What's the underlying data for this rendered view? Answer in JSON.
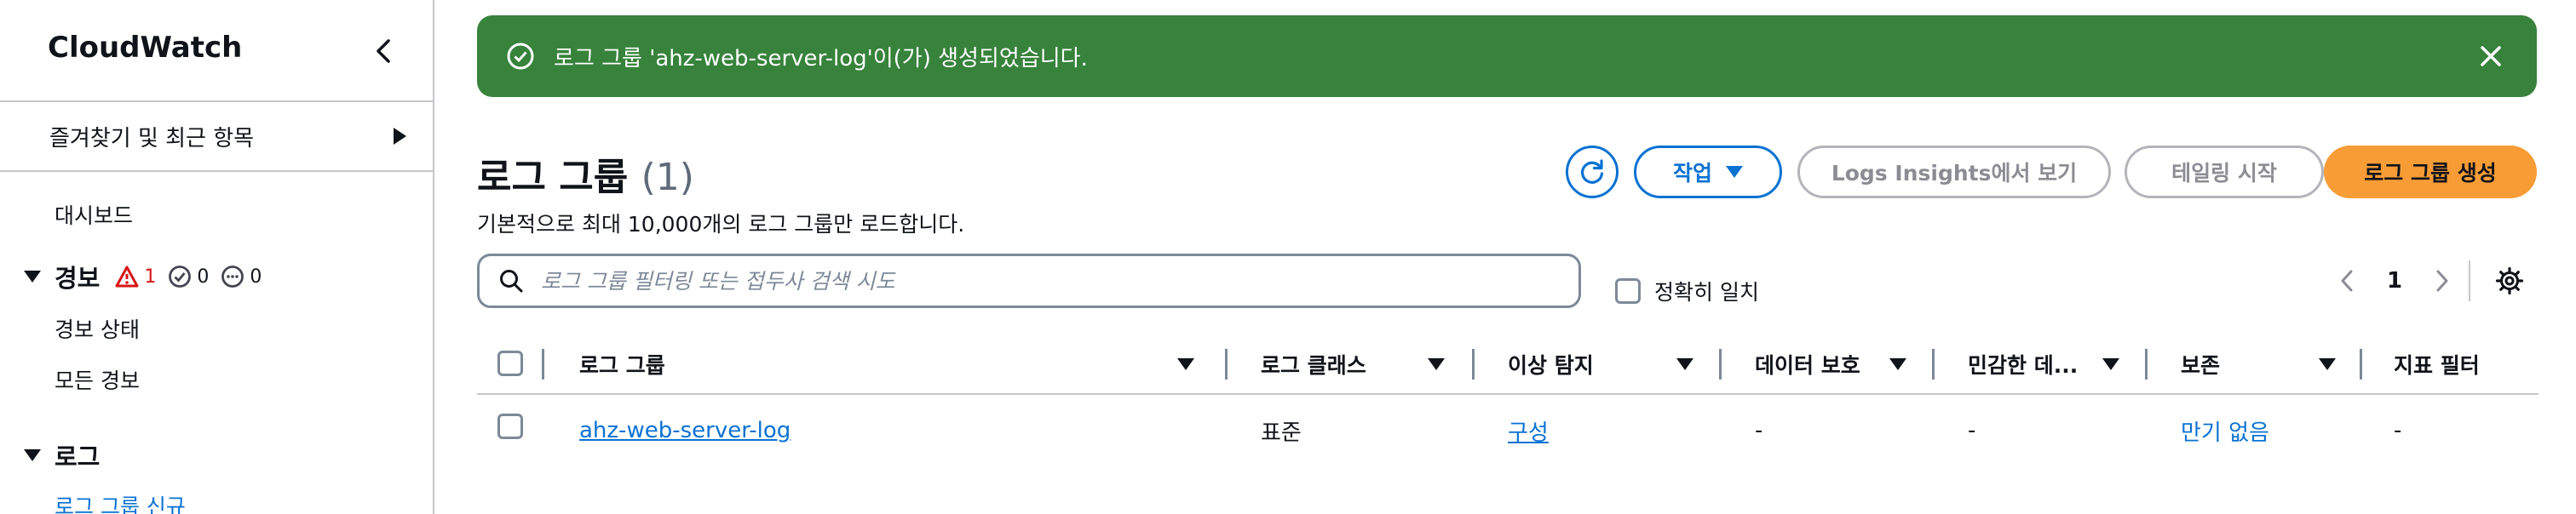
{
  "sidebar": {
    "title": "CloudWatch",
    "favorites": "즐겨찾기 및 최근 항목",
    "dashboard": "대시보드",
    "alarms": {
      "label": "경보",
      "in_alarm": "1",
      "ok": "0",
      "insufficient": "0",
      "status": "경보 상태",
      "all": "모든 경보"
    },
    "logs": {
      "label": "로그",
      "log_groups": "로그 그룹 신규"
    }
  },
  "flash": {
    "message": "로그 그룹 'ahz-web-server-log'이(가) 생성되었습니다."
  },
  "header": {
    "title": "로그 그룹",
    "count": "(1)",
    "description": "기본적으로 최대 10,000개의 로그 그룹만 로드합니다."
  },
  "buttons": {
    "actions": "작업",
    "insights": "Logs Insights에서 보기",
    "tail": "테일링 시작",
    "create": "로그 그룹 생성"
  },
  "filter": {
    "placeholder": "로그 그룹 필터링 또는 접두사 검색 시도",
    "exact_match": "정확히 일치"
  },
  "pagination": {
    "page": "1"
  },
  "table": {
    "columns": [
      "로그 그룹",
      "로그 클래스",
      "이상 탐지",
      "데이터 보호",
      "민감한 데...",
      "보존",
      "지표 필터"
    ],
    "rows": [
      {
        "name": "ahz-web-server-log",
        "class": "표준",
        "anomaly": "구성",
        "data_protection": "-",
        "sensitive": "-",
        "retention": "만기 없음",
        "metric_filters": "-"
      }
    ]
  },
  "colors": {
    "success": "#37833b",
    "primary": "#f89c36",
    "link": "#0972d3",
    "alarm": "#d91515"
  }
}
